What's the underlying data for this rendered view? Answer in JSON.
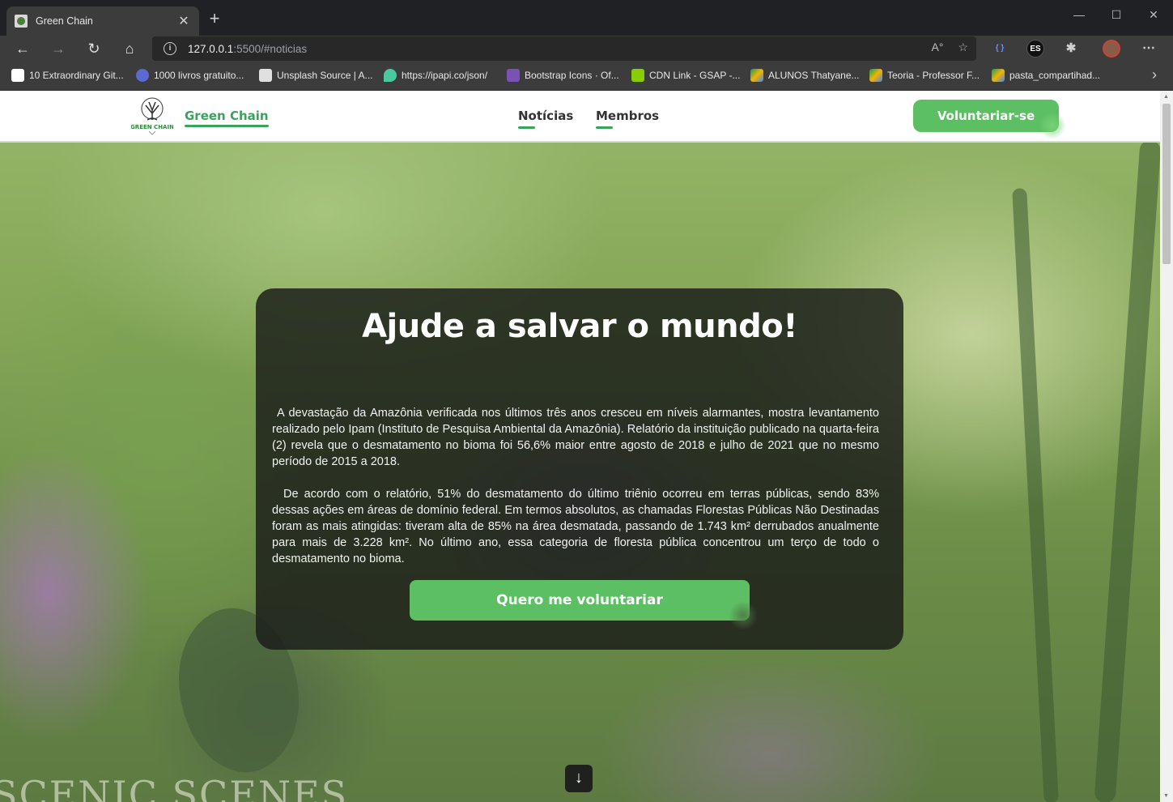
{
  "browser": {
    "tab_title": "Green Chain",
    "url_host": "127.0.0.1",
    "url_rest": ":5500/#noticias",
    "profile_ext_label": "ES",
    "bookmarks": [
      {
        "label": "10 Extraordinary Git...",
        "icon": "medium-icon",
        "color": "#ffffff"
      },
      {
        "label": "1000 livros gratuito...",
        "icon": "book-icon",
        "color": "#5a6ad0"
      },
      {
        "label": "Unsplash Source | A...",
        "icon": "unsplash-icon",
        "color": "#e0e0e0"
      },
      {
        "label": "https://ipapi.co/json/",
        "icon": "location-pin-icon",
        "color": "#4ac9a0"
      },
      {
        "label": "Bootstrap Icons · Of...",
        "icon": "bootstrap-icon",
        "color": "#7952b3"
      },
      {
        "label": "CDN Link - GSAP -...",
        "icon": "gsap-icon",
        "color": "#88ce02"
      },
      {
        "label": "ALUNOS Thatyane...",
        "icon": "drive-icon",
        "color": "#f4b400"
      },
      {
        "label": "Teoria - Professor F...",
        "icon": "drive-icon",
        "color": "#f4b400"
      },
      {
        "label": "pasta_compartihad...",
        "icon": "drive-icon",
        "color": "#f4b400"
      }
    ]
  },
  "nav": {
    "brand": "Green Chain",
    "links": [
      "Notícias",
      "Membros"
    ],
    "cta": "Voluntariar-se"
  },
  "hero": {
    "title": "Ajude a salvar o mundo!",
    "paragraph1": "A devastação da Amazônia verificada nos últimos três anos cresceu em níveis alarmantes, mostra levantamento realizado pelo Ipam (Instituto de Pesquisa Ambiental da Amazônia). Relatório da instituição publicado na quarta-feira (2) revela que o desmatamento no bioma foi 56,6% maior entre agosto de 2018 e julho de 2021 que no mesmo período de 2015 a 2018.",
    "paragraph2": "De acordo com o relatório, 51% do desmatamento do último triênio ocorreu em terras públicas, sendo 83% dessas ações em áreas de domínio federal. Em termos absolutos, as chamadas Florestas Públicas Não Destinadas foram as mais atingidas: tiveram alta de 85% na área desmatada, passando de 1.743 km² derrubados anualmente para mais de 3.228 km². No último ano, essa categoria de floresta pública concentrou um terço de todo o desmatamento no bioma.",
    "button": "Quero me voluntariar",
    "watermark": "SCENIC SCENES",
    "scroll_icon": "arrow-down-icon"
  },
  "colors": {
    "accent": "#5cbf63",
    "brand_text": "#3aa35b",
    "card_bg": "#1c1e1a"
  }
}
